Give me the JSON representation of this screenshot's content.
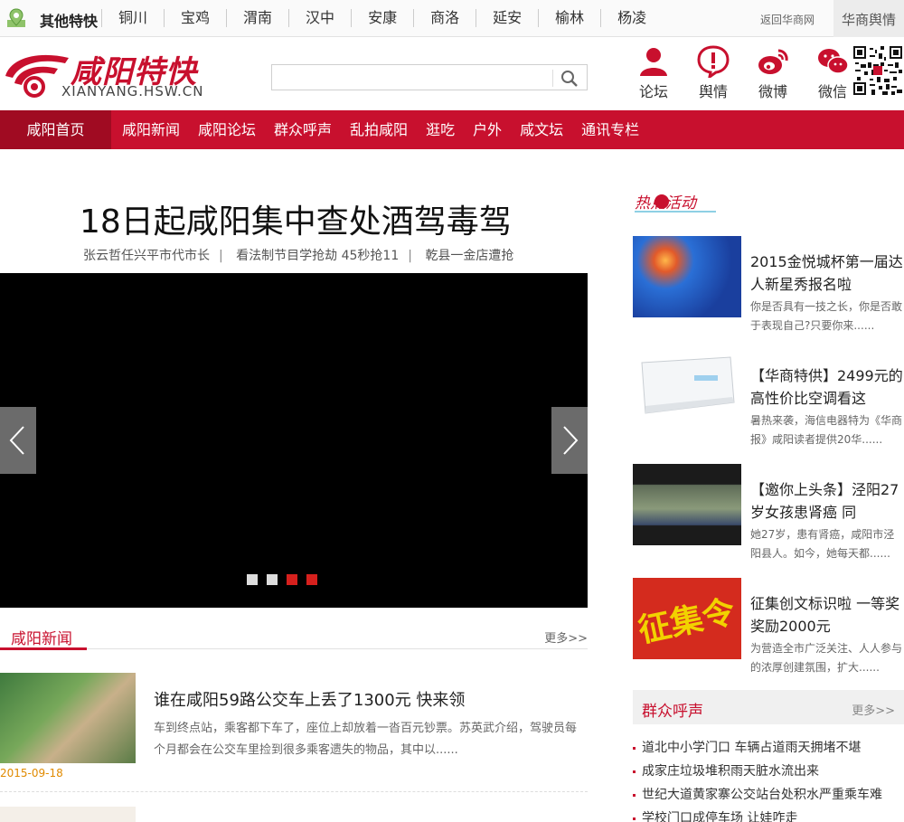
{
  "topbar": {
    "other_label": "其他特快",
    "cities": [
      "铜川",
      "宝鸡",
      "渭南",
      "汉中",
      "安康",
      "商洛",
      "延安",
      "榆林",
      "杨凌"
    ],
    "return_label": "返回华商网",
    "brand_tab": "华商舆情"
  },
  "header": {
    "logo_title": "咸阳特快",
    "logo_sub": "XIANYANG.HSW.CN",
    "search_value": "",
    "icons": [
      {
        "label": "论坛",
        "icon": "person-icon"
      },
      {
        "label": "舆情",
        "icon": "alert-bubble-icon"
      },
      {
        "label": "微博",
        "icon": "weibo-icon"
      },
      {
        "label": "微信",
        "icon": "wechat-icon"
      }
    ]
  },
  "nav": {
    "home": "咸阳首页",
    "items": [
      "咸阳新闻",
      "咸阳论坛",
      "群众呼声",
      "乱拍咸阳",
      "逛吃",
      "户外",
      "咸文坛",
      "通讯专栏"
    ]
  },
  "headline": {
    "title": "18日起咸阳集中查处酒驾毒驾",
    "sublinks": [
      "张云哲任兴平市代市长",
      "看法制节目学抢劫 45秒抢11",
      "乾县一金店遭抢"
    ]
  },
  "slider": {
    "dots": 4,
    "active_dots": [
      2,
      3
    ],
    "colors": {
      "inactive": "#dddddd",
      "active": "#d6201d"
    }
  },
  "news": {
    "section_title": "咸阳新闻",
    "more": "更多>>",
    "items": [
      {
        "title": "谁在咸阳59路公交车上丢了1300元 快来领",
        "summary": "车到终点站，乘客都下车了，座位上却放着一沓百元钞票。苏英武介绍，驾驶员每个月都会在公交车里捡到很多乘客遗失的物品，其中以......",
        "date": "2015-09-18"
      }
    ]
  },
  "hot": {
    "label": "热点活动",
    "cards": [
      {
        "title": "2015金悦城杯第一届达人新星秀报名啦",
        "desc": "你是否具有一技之长，你是否敢于表现自己?只要你来......"
      },
      {
        "title": "【华商特供】2499元的高性价比空调看这",
        "desc": "暑热来袭，海信电器特为《华商报》咸阳读者提供20华......"
      },
      {
        "title": "【邀你上头条】泾阳27岁女孩患肾癌 同",
        "desc": "她27岁，患有肾癌，咸阳市泾阳县人。如今，她每天都......"
      },
      {
        "title": "征集创文标识啦 一等奖奖励2000元",
        "desc": "为营造全市广泛关注、人人参与的浓厚创建氛围，扩大......",
        "img_text": "征集令"
      }
    ]
  },
  "voices": {
    "title": "群众呼声",
    "more": "更多>>",
    "items": [
      "道北中小学门口 车辆占道雨天拥堵不堪",
      "成家庄垃圾堆积雨天脏水流出来",
      "世纪大道黄家寨公交站台处积水严重乘车难",
      "学校门口成停车场 让娃咋走"
    ]
  },
  "colors": {
    "brand": "#c8102e",
    "date": "#e08a00"
  }
}
